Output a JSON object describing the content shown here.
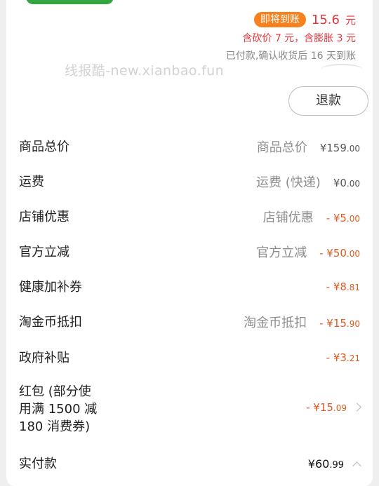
{
  "top": {
    "status_pill": "即将到账",
    "amount": "15.6",
    "amount_unit": "元",
    "detail_line": "含砍价 7 元，含膨胀 3 元",
    "confirm_line": "已付款,确认收货后 16 天到账"
  },
  "watermark": "线报酷-new.xianbao.fun",
  "refund_label": "退款",
  "rows": [
    {
      "label": "商品总价",
      "mid": "商品总价",
      "sign": "",
      "cur": "¥",
      "int": "159",
      "dec": ".00"
    },
    {
      "label": "运费",
      "mid": "运费 (快递)",
      "sign": "",
      "cur": "¥",
      "int": "0",
      "dec": ".00"
    },
    {
      "label": "店铺优惠",
      "mid": "店铺优惠",
      "sign": "- ",
      "cur": "¥",
      "int": "5",
      "dec": ".00"
    },
    {
      "label": "官方立减",
      "mid": "官方立减",
      "sign": "- ",
      "cur": "¥",
      "int": "50",
      "dec": ".00"
    },
    {
      "label": "健康加补券",
      "mid": "",
      "sign": "- ",
      "cur": "¥",
      "int": "8",
      "dec": ".81"
    },
    {
      "label": "淘金币抵扣",
      "mid": "淘金币抵扣",
      "sign": "- ",
      "cur": "¥",
      "int": "15",
      "dec": ".90"
    },
    {
      "label": "政府补贴",
      "mid": "",
      "sign": "- ",
      "cur": "¥",
      "int": "3",
      "dec": ".21"
    },
    {
      "label": "红包 (部分使\n用满 1500 减\n180 消费券)",
      "mid": "",
      "sign": "- ",
      "cur": "¥",
      "int": "15",
      "dec": ".09"
    },
    {
      "label": "实付款",
      "mid": "",
      "sign": "",
      "cur": "¥",
      "int": "60",
      "dec": ".99"
    }
  ],
  "colors": {
    "pill": "#f5821f",
    "red": "#e6343c",
    "discount": "#e25a1f",
    "badge_green": "#33a63f"
  }
}
